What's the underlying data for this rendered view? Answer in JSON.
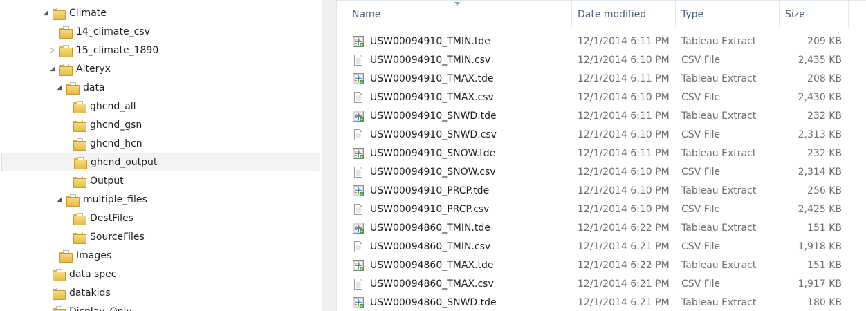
{
  "nav": {
    "items": [
      {
        "label": "Climate",
        "arrow": "◢",
        "indent": 60
      },
      {
        "label": "14_climate_csv",
        "arrow": "",
        "indent": 70
      },
      {
        "label": "15_climate_1890",
        "arrow": "▷",
        "indent": 70
      },
      {
        "label": "Alteryx",
        "arrow": "◢",
        "indent": 70
      },
      {
        "label": "data",
        "arrow": "◢",
        "indent": 80
      },
      {
        "label": "ghcnd_all",
        "arrow": "",
        "indent": 90
      },
      {
        "label": "ghcnd_gsn",
        "arrow": "",
        "indent": 90
      },
      {
        "label": "ghcnd_hcn",
        "arrow": "",
        "indent": 90
      },
      {
        "label": "ghcnd_output",
        "arrow": "",
        "indent": 90,
        "selected": true
      },
      {
        "label": "Output",
        "arrow": "",
        "indent": 90
      },
      {
        "label": "multiple_files",
        "arrow": "◢",
        "indent": 80
      },
      {
        "label": "DestFiles",
        "arrow": "",
        "indent": 90
      },
      {
        "label": "SourceFiles",
        "arrow": "",
        "indent": 90
      },
      {
        "label": "Images",
        "arrow": "",
        "indent": 70
      },
      {
        "label": "data spec",
        "arrow": "",
        "indent": 60
      },
      {
        "label": "datakids",
        "arrow": "",
        "indent": 60
      },
      {
        "label": "Display_Only",
        "arrow": "",
        "indent": 60
      }
    ]
  },
  "list": {
    "headers": {
      "name": "Name",
      "date": "Date modified",
      "type": "Type",
      "size": "Size"
    },
    "files": [
      {
        "name": "USW00094910_TMIN.tde",
        "date": "12/1/2014 6:11 PM",
        "type": "Tableau Extract",
        "size": "209 KB",
        "icon": "tableau-extract-icon"
      },
      {
        "name": "USW00094910_TMIN.csv",
        "date": "12/1/2014 6:10 PM",
        "type": "CSV File",
        "size": "2,435 KB",
        "icon": "csv-file-icon"
      },
      {
        "name": "USW00094910_TMAX.tde",
        "date": "12/1/2014 6:11 PM",
        "type": "Tableau Extract",
        "size": "208 KB",
        "icon": "tableau-extract-icon"
      },
      {
        "name": "USW00094910_TMAX.csv",
        "date": "12/1/2014 6:10 PM",
        "type": "CSV File",
        "size": "2,430 KB",
        "icon": "csv-file-icon"
      },
      {
        "name": "USW00094910_SNWD.tde",
        "date": "12/1/2014 6:11 PM",
        "type": "Tableau Extract",
        "size": "232 KB",
        "icon": "tableau-extract-icon"
      },
      {
        "name": "USW00094910_SNWD.csv",
        "date": "12/1/2014 6:10 PM",
        "type": "CSV File",
        "size": "2,313 KB",
        "icon": "csv-file-icon"
      },
      {
        "name": "USW00094910_SNOW.tde",
        "date": "12/1/2014 6:11 PM",
        "type": "Tableau Extract",
        "size": "232 KB",
        "icon": "tableau-extract-icon"
      },
      {
        "name": "USW00094910_SNOW.csv",
        "date": "12/1/2014 6:10 PM",
        "type": "CSV File",
        "size": "2,314 KB",
        "icon": "csv-file-icon"
      },
      {
        "name": "USW00094910_PRCP.tde",
        "date": "12/1/2014 6:10 PM",
        "type": "Tableau Extract",
        "size": "256 KB",
        "icon": "tableau-extract-icon"
      },
      {
        "name": "USW00094910_PRCP.csv",
        "date": "12/1/2014 6:10 PM",
        "type": "CSV File",
        "size": "2,425 KB",
        "icon": "csv-file-icon"
      },
      {
        "name": "USW00094860_TMIN.tde",
        "date": "12/1/2014 6:22 PM",
        "type": "Tableau Extract",
        "size": "151 KB",
        "icon": "tableau-extract-icon"
      },
      {
        "name": "USW00094860_TMIN.csv",
        "date": "12/1/2014 6:21 PM",
        "type": "CSV File",
        "size": "1,918 KB",
        "icon": "csv-file-icon"
      },
      {
        "name": "USW00094860_TMAX.tde",
        "date": "12/1/2014 6:22 PM",
        "type": "Tableau Extract",
        "size": "151 KB",
        "icon": "tableau-extract-icon"
      },
      {
        "name": "USW00094860_TMAX.csv",
        "date": "12/1/2014 6:21 PM",
        "type": "CSV File",
        "size": "1,917 KB",
        "icon": "csv-file-icon"
      },
      {
        "name": "USW00094860_SNWD.tde",
        "date": "12/1/2014 6:21 PM",
        "type": "Tableau Extract",
        "size": "180 KB",
        "icon": "tableau-extract-icon"
      }
    ]
  },
  "colors": {
    "header_text": "#4c607a",
    "secondary_text": "#6d6d6d",
    "folder": "#e7b94a",
    "selection_bg": "#f3f3f3"
  }
}
